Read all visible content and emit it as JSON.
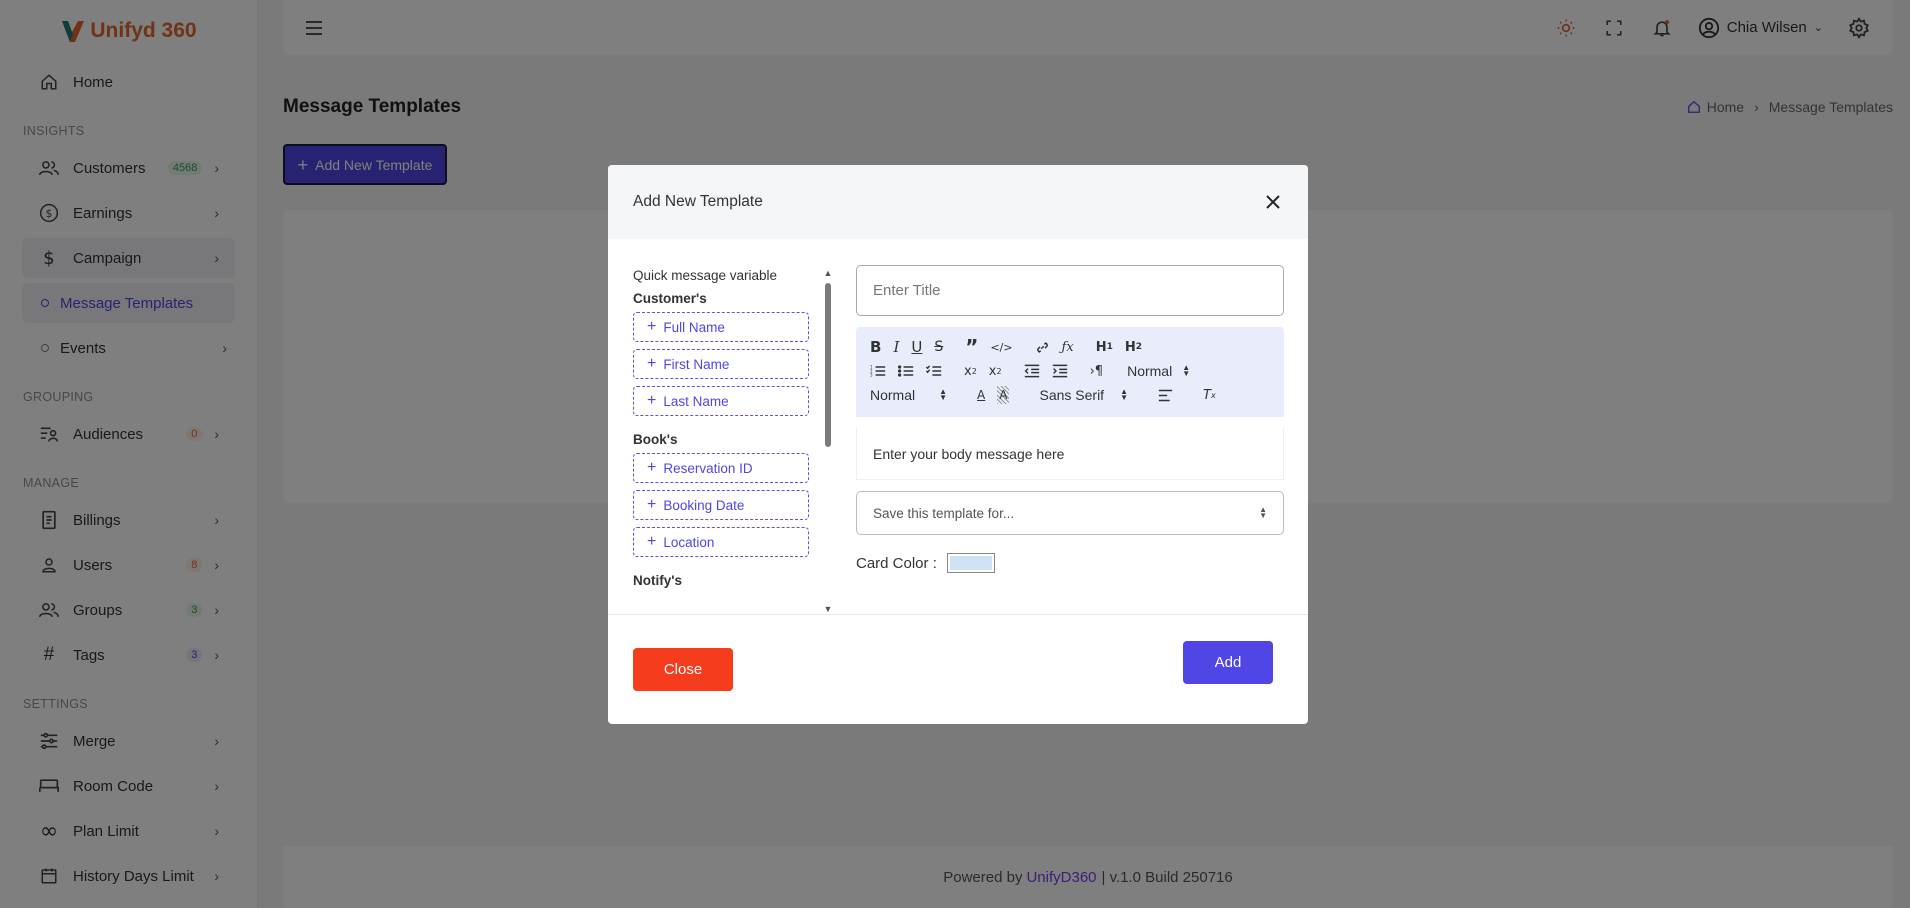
{
  "app": {
    "brand": "Unifyd 360"
  },
  "sidebar": {
    "home": "Home",
    "sections": {
      "insights": "INSIGHTS",
      "grouping": "GROUPING",
      "manage": "MANAGE",
      "settings": "SETTINGS"
    },
    "items": {
      "customers": {
        "label": "Customers",
        "badge": "4568"
      },
      "earnings": {
        "label": "Earnings"
      },
      "campaign": {
        "label": "Campaign"
      },
      "message_templates": {
        "label": "Message Templates"
      },
      "events": {
        "label": "Events"
      },
      "audiences": {
        "label": "Audiences",
        "badge": "0"
      },
      "billings": {
        "label": "Billings"
      },
      "users": {
        "label": "Users",
        "badge": "8"
      },
      "groups": {
        "label": "Groups",
        "badge": "3"
      },
      "tags": {
        "label": "Tags",
        "badge": "3"
      },
      "merge": {
        "label": "Merge"
      },
      "room_code": {
        "label": "Room Code"
      },
      "plan_limit": {
        "label": "Plan Limit"
      },
      "history_days_limit": {
        "label": "History Days Limit"
      }
    }
  },
  "topbar": {
    "user_name": "Chia Wilsen"
  },
  "page": {
    "title": "Message Templates",
    "breadcrumb": {
      "home": "Home",
      "current": "Message Templates"
    },
    "add_button": "Add New Template"
  },
  "footer": {
    "prefix": "Powered by",
    "brand": "UnifyD360",
    "build": "| v.1.0 Build 250716"
  },
  "modal": {
    "title": "Add New Template",
    "variables": {
      "heading": "Quick message variable",
      "groups": [
        {
          "name": "Customer's",
          "items": [
            "Full Name",
            "First Name",
            "Last Name"
          ]
        },
        {
          "name": "Book's",
          "items": [
            "Reservation ID",
            "Booking Date",
            "Location"
          ]
        },
        {
          "name": "Notify's",
          "items": []
        }
      ]
    },
    "title_placeholder": "Enter Title",
    "toolbar": {
      "header_select": "Normal",
      "size_select": "Normal",
      "font_select": "Sans Serif"
    },
    "body_placeholder": "Enter your body message here",
    "save_for_placeholder": "Save this template for...",
    "card_color_label": "Card Color :",
    "card_color": "#cfe3f7",
    "close_button": "Close",
    "add_button": "Add"
  },
  "colors": {
    "accent": "#4f46e5",
    "brand_orange": "#e0662a",
    "danger": "#f53d1e"
  }
}
